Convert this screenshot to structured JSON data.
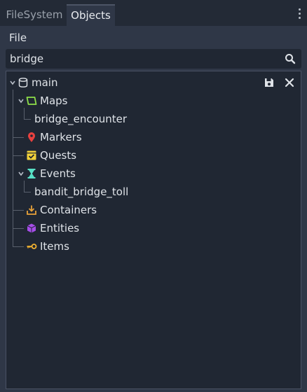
{
  "tabs": [
    {
      "label": "FileSystem",
      "active": false
    },
    {
      "label": "Objects",
      "active": true
    }
  ],
  "menu": {
    "file_label": "File"
  },
  "search": {
    "value": "bridge",
    "icon": "search-icon"
  },
  "tree": {
    "root": {
      "label": "main",
      "icon": "database-icon",
      "actions": [
        "save-icon",
        "close-icon"
      ]
    },
    "items": [
      {
        "label": "Maps",
        "icon": "map-icon",
        "color": "#8ee04a",
        "expanded": true,
        "children": [
          {
            "label": "bridge_encounter"
          }
        ]
      },
      {
        "label": "Markers",
        "icon": "marker-icon",
        "color": "#e8413f"
      },
      {
        "label": "Quests",
        "icon": "quest-icon",
        "color": "#f2d23a"
      },
      {
        "label": "Events",
        "icon": "hourglass-icon",
        "color": "#58e0c6",
        "expanded": true,
        "children": [
          {
            "label": "bandit_bridge_toll"
          }
        ]
      },
      {
        "label": "Containers",
        "icon": "container-icon",
        "color": "#e8a23a"
      },
      {
        "label": "Entities",
        "icon": "cube-icon",
        "color": "#a64de8"
      },
      {
        "label": "Items",
        "icon": "key-icon",
        "color": "#f2b230"
      }
    ]
  }
}
